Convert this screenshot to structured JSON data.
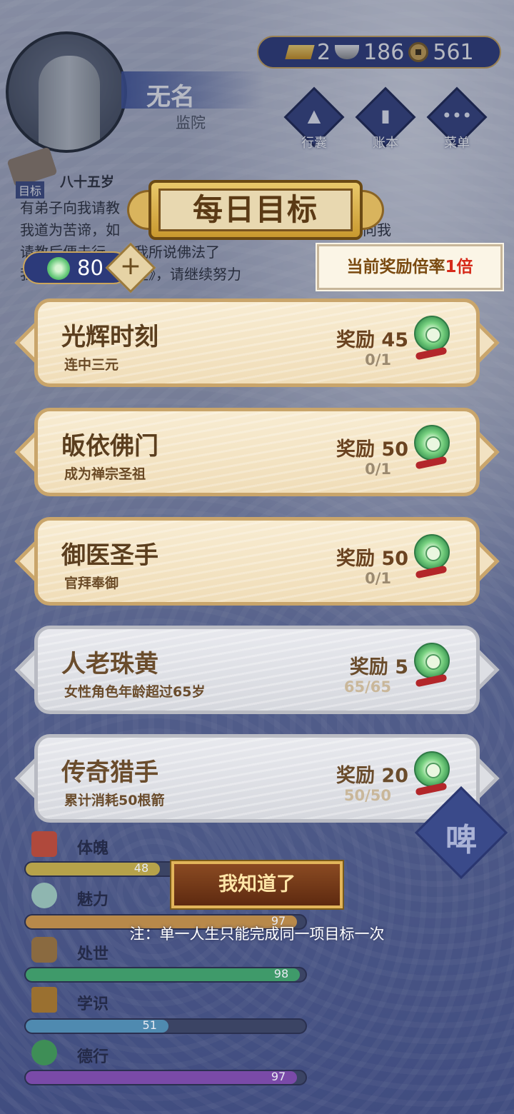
{
  "header": {
    "name": "无名",
    "rank": "监院",
    "currencies": {
      "gold": "2",
      "silver": "186",
      "coins": "561"
    },
    "buttons": [
      {
        "label": "行囊",
        "glyph": "▲"
      },
      {
        "label": "账本",
        "glyph": "▮"
      },
      {
        "label": "菜单",
        "glyph": "•••"
      }
    ]
  },
  "life": {
    "age": "八十五岁",
    "goal_tag": "目标",
    "lines": [
      "有弟子向我请教　　　　　　　　　　　　　　何谛？",
      "我道为苦谛，如　　　　　　　　　　　　似懂非懂，向我",
      "请教后便去行　　我所说佛法了",
      "我　　　　　　　经》，请继续努力"
    ],
    "jade_count": "80"
  },
  "dialog": {
    "title": "每日目标",
    "multiplier_prefix": "当前奖励倍率",
    "multiplier_value": "1倍",
    "goals": [
      {
        "title": "光辉时刻",
        "desc": "连中三元",
        "reward": "奖励 45",
        "progress": "0/1",
        "done": false
      },
      {
        "title": "皈依佛门",
        "desc": "成为禅宗圣祖",
        "reward": "奖励 50",
        "progress": "0/1",
        "done": false
      },
      {
        "title": "御医圣手",
        "desc": "官拜奉御",
        "reward": "奖励 50",
        "progress": "0/1",
        "done": false
      },
      {
        "title": "人老珠黄",
        "desc": "女性角色年龄超过65岁",
        "reward": "奖励 5",
        "progress": "65/65",
        "done": true
      },
      {
        "title": "传奇猎手",
        "desc": "累计消耗50根箭",
        "reward": "奖励 20",
        "progress": "50/50",
        "done": true
      }
    ],
    "confirm_label": "我知道了",
    "note": "注：单一人生只能完成同一项目标一次"
  },
  "stats": [
    {
      "name": "体魄",
      "value": "48",
      "ratio": 0.48,
      "color": "#b6a24a"
    },
    {
      "name": "魅力",
      "value": "97",
      "ratio": 0.97,
      "color": "#b8894a"
    },
    {
      "name": "处世",
      "value": "98",
      "ratio": 0.98,
      "color": "#3f9a6a"
    },
    {
      "name": "学识",
      "value": "51",
      "ratio": 0.51,
      "color": "#4f8ab0"
    },
    {
      "name": "德行",
      "value": "97",
      "ratio": 0.97,
      "color": "#7a4aa8"
    }
  ],
  "seal_char": "啤"
}
